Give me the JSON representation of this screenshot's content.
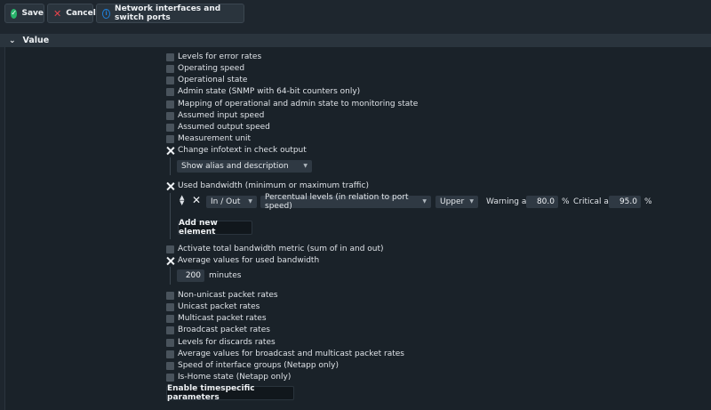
{
  "toolbar": {
    "save_label": "Save",
    "cancel_label": "Cancel",
    "info_label": "Network interfaces and switch ports"
  },
  "section": {
    "title": "Value"
  },
  "options_top": [
    {
      "label": "Levels for error rates",
      "checked": false
    },
    {
      "label": "Operating speed",
      "checked": false
    },
    {
      "label": "Operational state",
      "checked": false
    },
    {
      "label": "Admin state (SNMP with 64-bit counters only)",
      "checked": false
    },
    {
      "label": "Mapping of operational and admin state to monitoring state",
      "checked": false
    },
    {
      "label": "Assumed input speed",
      "checked": false
    },
    {
      "label": "Assumed output speed",
      "checked": false
    },
    {
      "label": "Measurement unit",
      "checked": false
    },
    {
      "label": "Change infotext in check output",
      "checked": true
    }
  ],
  "infotext": {
    "selected": "Show alias and description"
  },
  "bandwidth": {
    "label": "Used bandwidth (minimum or maximum traffic)",
    "checked": true,
    "direction": "In / Out",
    "mode": "Percentual levels (in relation to port speed)",
    "bound": "Upper",
    "warning_label": "Warning at",
    "warning_value": "80.0",
    "critical_label": "Critical at",
    "critical_value": "95.0",
    "unit": "%",
    "add_label": "Add new element"
  },
  "total_bandwidth": {
    "label": "Activate total bandwidth metric (sum of in and out)",
    "checked": false
  },
  "average": {
    "label": "Average values for used bandwidth",
    "checked": true,
    "value": "200",
    "unit": "minutes"
  },
  "options_bottom": [
    {
      "label": "Non-unicast packet rates",
      "checked": false
    },
    {
      "label": "Unicast packet rates",
      "checked": false
    },
    {
      "label": "Multicast packet rates",
      "checked": false
    },
    {
      "label": "Broadcast packet rates",
      "checked": false
    },
    {
      "label": "Levels for discards rates",
      "checked": false
    },
    {
      "label": "Average values for broadcast and multicast packet rates",
      "checked": false
    },
    {
      "label": "Speed of interface groups (Netapp only)",
      "checked": false
    },
    {
      "label": "Is-Home state (Netapp only)",
      "checked": false
    }
  ],
  "timespecific_label": "Enable timespecific parameters",
  "colors": {
    "background": "#1e262e",
    "save_icon": "#27b36a",
    "cancel_icon": "#e5434b",
    "info_icon": "#1e7ed8"
  },
  "icons": [
    "check-circle-icon",
    "close-icon",
    "info-icon",
    "chevron-down-icon",
    "reorder-icon",
    "delete-icon"
  ]
}
